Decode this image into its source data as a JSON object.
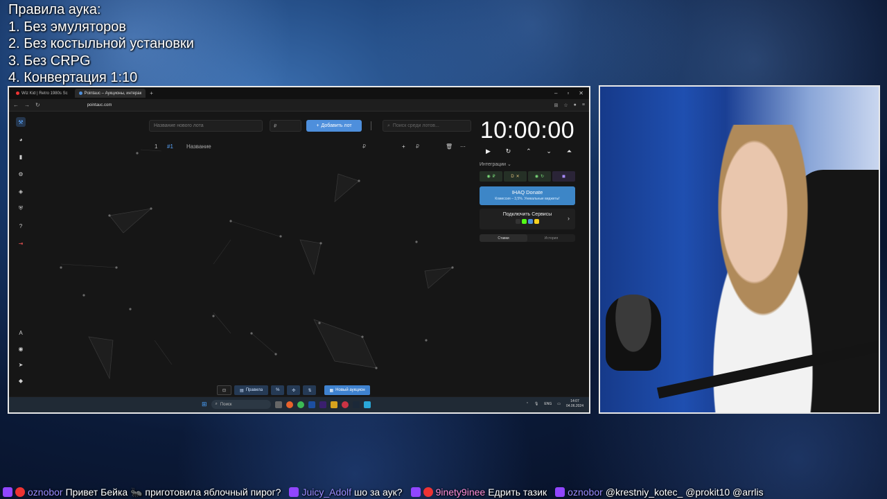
{
  "overlay": {
    "rules_title": "Правила аука:",
    "rules": [
      "1. Без эмуляторов",
      "2. Без костыльной установки",
      "3. Без CRPG",
      "4. Конвертация 1:10"
    ]
  },
  "browser": {
    "tabs": [
      {
        "label": "Wiz Kid | Retro 1980s Sc"
      },
      {
        "label": "Pointauc – Аукционы, интерак"
      }
    ],
    "url": "pointauc.com"
  },
  "app": {
    "lot_name_placeholder": "Название нового лота",
    "price_placeholder": "₽",
    "add_lot_label": "Добавить лот",
    "search_placeholder": "Поиск среди лотов...",
    "lot_row": {
      "index": "1",
      "id": "#1",
      "name": "Название",
      "currency": "₽",
      "price_currency": "₽"
    },
    "timer": "10:00:00",
    "integrations_label": "Интеграции",
    "integrations": [
      {
        "label": "₽"
      },
      {
        "label": "D"
      },
      {
        "label": ""
      }
    ],
    "donate_title": "IHAQ Donate",
    "donate_subtitle": "Комиссия – 3,5%. Уникальные виджеты!",
    "services_title": "Подключить Сервисы",
    "bids_tabs": [
      {
        "label": "Ставки"
      },
      {
        "label": "История"
      }
    ],
    "bottom_bar": {
      "rules_label": "Правила",
      "new_auction_label": "Новый аукцион"
    }
  },
  "taskbar": {
    "search_label": "Поиск",
    "lang": "ENG",
    "time": "14:07",
    "date": "04.06.2024"
  },
  "chat": [
    {
      "user": "oznobor",
      "message": "Привет Бейка 🐜 приготовила яблочный пирог?"
    },
    {
      "user": "Juicy_Adolf",
      "message": "шо за аук?"
    },
    {
      "user": "9inety9ineе",
      "message": "Едрить тазик"
    },
    {
      "user": "oznobor",
      "message": "@krestniy_kotec_ @prokit10 @arrlis"
    }
  ]
}
